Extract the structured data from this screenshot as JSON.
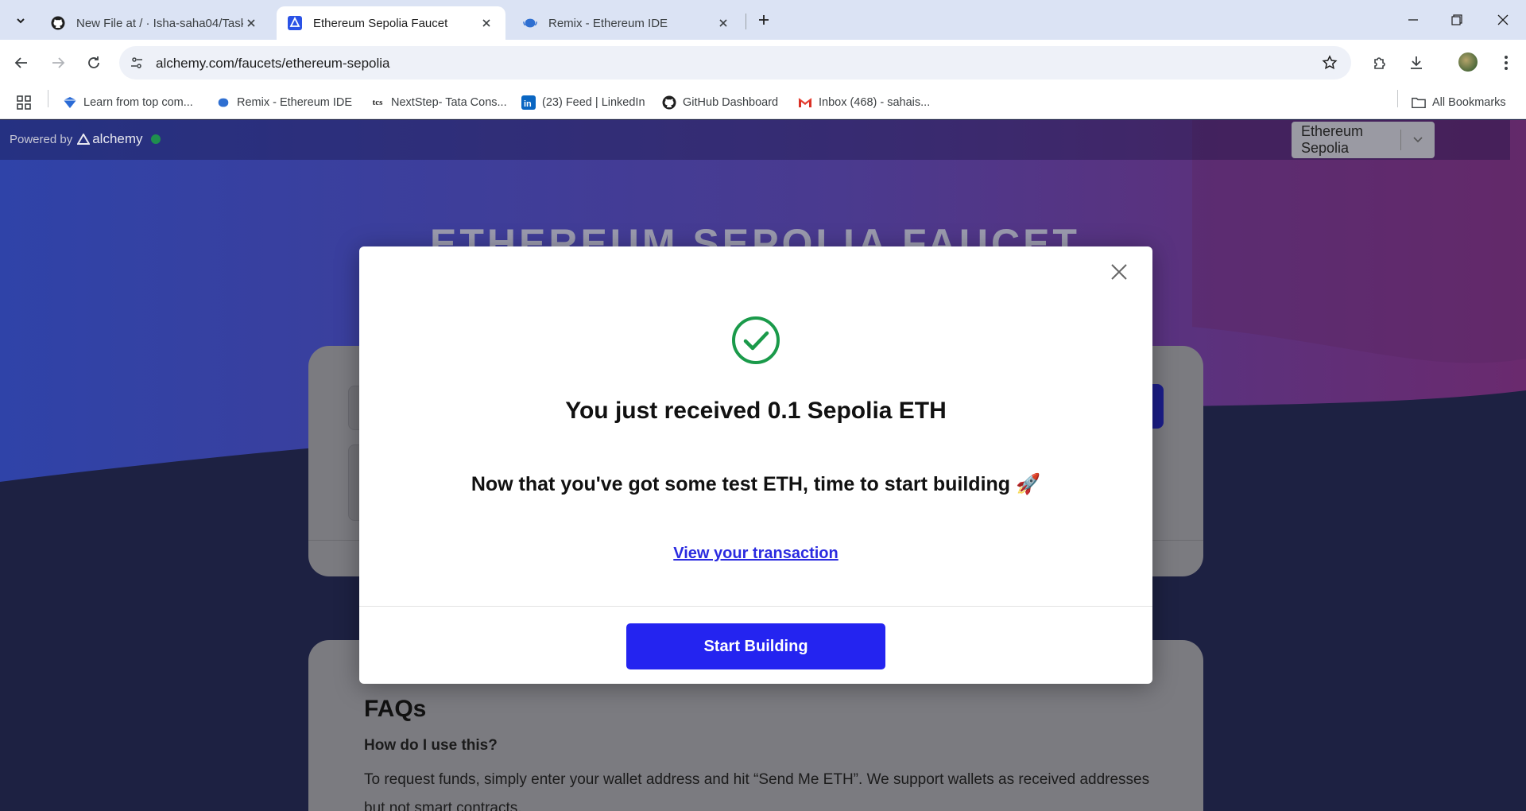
{
  "browser": {
    "tabs": [
      {
        "title": "New File at / · Isha-saha04/Task",
        "active": false,
        "icon": "github-icon"
      },
      {
        "title": "Ethereum Sepolia Faucet",
        "active": true,
        "icon": "alchemy-icon"
      },
      {
        "title": "Remix - Ethereum IDE",
        "active": false,
        "icon": "remix-icon"
      }
    ],
    "url": "alchemy.com/faucets/ethereum-sepolia",
    "bookmarks": [
      {
        "label": "Learn from top com...",
        "icon": "bookmark-learn-icon"
      },
      {
        "label": "Remix - Ethereum IDE",
        "icon": "remix-icon"
      },
      {
        "label": "NextStep- Tata Cons...",
        "icon": "tcs-icon"
      },
      {
        "label": "(23) Feed | LinkedIn",
        "icon": "linkedin-icon"
      },
      {
        "label": "GitHub Dashboard",
        "icon": "github-icon"
      },
      {
        "label": "Inbox (468) - sahais...",
        "icon": "gmail-icon"
      }
    ],
    "all_bookmarks": "All Bookmarks"
  },
  "page": {
    "powered_by": "Powered by",
    "brand": "alchemy",
    "network": "Ethereum Sepolia",
    "hero_title": "ETHEREUM SEPOLIA FAUCET",
    "faq_title": "FAQs",
    "faq_question": "How do I use this?",
    "faq_answer": "To request funds, simply enter your wallet address and hit “Send Me ETH”. We support wallets as received addresses but not smart contracts."
  },
  "modal": {
    "title": "You just received 0.1 Sepolia ETH",
    "subtitle": "Now that you've got some test ETH, time to start building 🚀",
    "link": "View your transaction",
    "button": "Start Building"
  },
  "colors": {
    "accent": "#2424f0",
    "success": "#1a9a4a",
    "link": "#2b2be0"
  }
}
